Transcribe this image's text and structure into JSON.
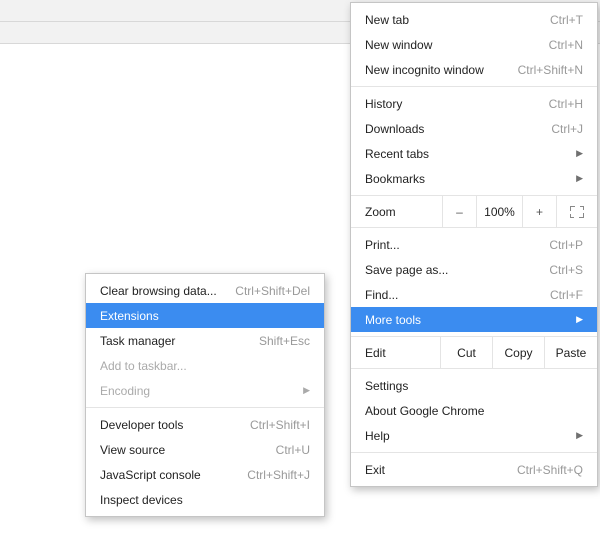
{
  "main_menu": {
    "new_tab": {
      "label": "New tab",
      "shortcut": "Ctrl+T"
    },
    "new_window": {
      "label": "New window",
      "shortcut": "Ctrl+N"
    },
    "new_incognito": {
      "label": "New incognito window",
      "shortcut": "Ctrl+Shift+N"
    },
    "history": {
      "label": "History",
      "shortcut": "Ctrl+H"
    },
    "downloads": {
      "label": "Downloads",
      "shortcut": "Ctrl+J"
    },
    "recent_tabs": {
      "label": "Recent tabs"
    },
    "bookmarks": {
      "label": "Bookmarks"
    },
    "zoom": {
      "label": "Zoom",
      "minus": "–",
      "percent": "100%",
      "plus": "+"
    },
    "print": {
      "label": "Print...",
      "shortcut": "Ctrl+P"
    },
    "save_as": {
      "label": "Save page as...",
      "shortcut": "Ctrl+S"
    },
    "find": {
      "label": "Find...",
      "shortcut": "Ctrl+F"
    },
    "more_tools": {
      "label": "More tools"
    },
    "edit": {
      "label": "Edit",
      "cut": "Cut",
      "copy": "Copy",
      "paste": "Paste"
    },
    "settings": {
      "label": "Settings"
    },
    "about": {
      "label": "About Google Chrome"
    },
    "help": {
      "label": "Help"
    },
    "exit": {
      "label": "Exit",
      "shortcut": "Ctrl+Shift+Q"
    }
  },
  "submenu": {
    "clear_browsing": {
      "label": "Clear browsing data...",
      "shortcut": "Ctrl+Shift+Del"
    },
    "extensions": {
      "label": "Extensions"
    },
    "task_manager": {
      "label": "Task manager",
      "shortcut": "Shift+Esc"
    },
    "add_taskbar": {
      "label": "Add to taskbar..."
    },
    "encoding": {
      "label": "Encoding"
    },
    "dev_tools": {
      "label": "Developer tools",
      "shortcut": "Ctrl+Shift+I"
    },
    "view_source": {
      "label": "View source",
      "shortcut": "Ctrl+U"
    },
    "js_console": {
      "label": "JavaScript console",
      "shortcut": "Ctrl+Shift+J"
    },
    "inspect": {
      "label": "Inspect devices"
    }
  }
}
